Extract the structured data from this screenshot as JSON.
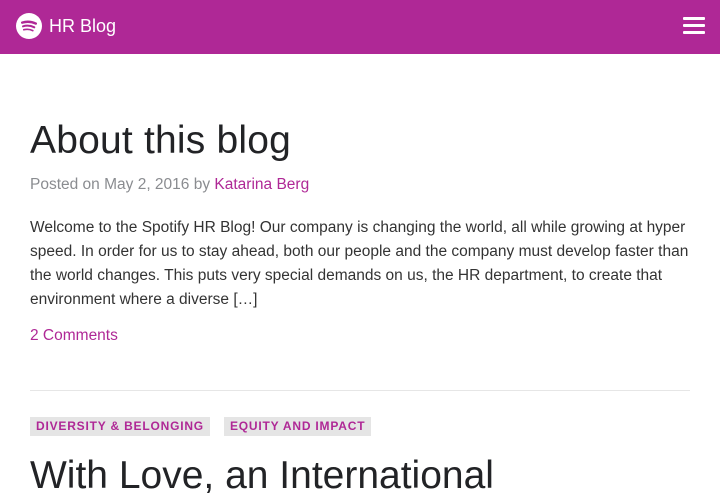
{
  "header": {
    "title": "HR Blog",
    "logo_icon": "spotify-logo-icon",
    "menu_icon": "hamburger-menu-icon",
    "background": "#af2896"
  },
  "post": {
    "title": "About this blog",
    "meta_prefix": "Posted on ",
    "date": "May 2, 2016",
    "by": " by ",
    "author": "Katarina Berg",
    "excerpt": "Welcome to the Spotify HR Blog! Our company is changing the world, all while growing at hyper speed. In order for us to stay ahead, both our people and the company must develop faster than the world changes. This puts very special demands on us, the HR department, to create that environment where a diverse […]",
    "comments": "2 Comments"
  },
  "next_post": {
    "tags": [
      "DIVERSITY & BELONGING",
      "EQUITY AND IMPACT"
    ],
    "title": "With Love, an International"
  },
  "colors": {
    "accent": "#af2896",
    "text": "#222326",
    "muted": "#8a8c90",
    "tag_bg": "#e5e5e5"
  }
}
